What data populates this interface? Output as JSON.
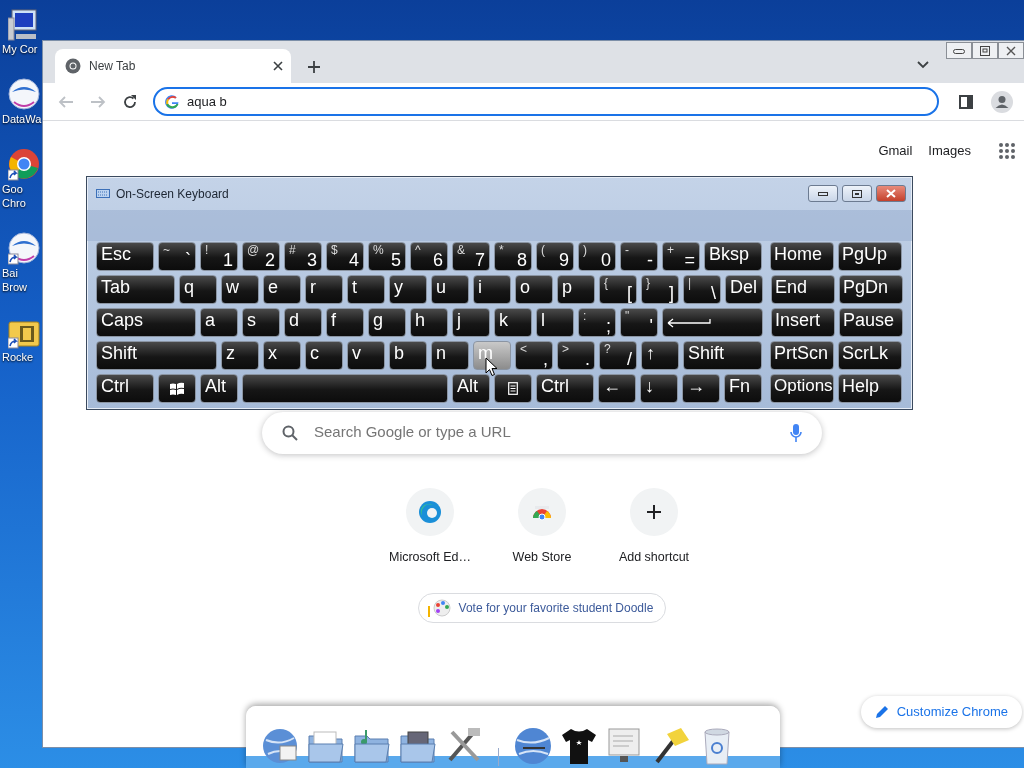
{
  "desktop": {
    "icons": [
      {
        "lines": [
          "My Cor"
        ],
        "shortcut": false
      },
      {
        "lines": [
          "DataWa"
        ],
        "shortcut": false
      },
      {
        "lines": [
          "Goo",
          "Chro"
        ],
        "shortcut": true
      },
      {
        "lines": [
          "Bai",
          "Brow"
        ],
        "shortcut": true
      },
      {
        "lines": [
          "Rocke"
        ],
        "shortcut": true
      }
    ]
  },
  "browser": {
    "tabs": [
      {
        "title": "New Tab",
        "selected": true
      }
    ],
    "nav_buttons": [
      {
        "kind": "back",
        "disabled": true
      },
      {
        "kind": "forward",
        "disabled": true
      },
      {
        "kind": "reload",
        "disabled": false
      }
    ],
    "address": {
      "value": "aqua b"
    },
    "top_links": [
      "Gmail",
      "Images"
    ],
    "search": {
      "placeholder": "Search Google or type a URL"
    },
    "shortcuts": [
      {
        "label": "Microsoft Ed…",
        "kind": "edge"
      },
      {
        "label": "Web Store",
        "kind": "store"
      },
      {
        "label": "Add shortcut",
        "kind": "add"
      }
    ],
    "doodle_chip": {
      "label": "Vote for your favorite student Doodle"
    },
    "customize_button": {
      "label": "Customize Chrome"
    }
  },
  "keyboard_window": {
    "title": "On-Screen Keyboard",
    "rows": [
      {
        "main": [
          {
            "label": "Esc",
            "kind": "medium",
            "hovered": false
          },
          {
            "shift": "~",
            "label": "`",
            "kind": "key",
            "hovered": false
          },
          {
            "shift": "!",
            "label": "1",
            "kind": "key",
            "hovered": false
          },
          {
            "shift": "@",
            "label": "2",
            "kind": "key",
            "hovered": false
          },
          {
            "shift": "#",
            "label": "3",
            "kind": "key",
            "hovered": false
          },
          {
            "shift": "$",
            "label": "4",
            "kind": "key",
            "hovered": false
          },
          {
            "shift": "%",
            "label": "5",
            "kind": "key",
            "hovered": false
          },
          {
            "shift": "^",
            "label": "6",
            "kind": "key",
            "hovered": false
          },
          {
            "shift": "&",
            "label": "7",
            "kind": "key",
            "hovered": false
          },
          {
            "shift": "*",
            "label": "8",
            "kind": "key",
            "hovered": false
          },
          {
            "shift": "(",
            "label": "9",
            "kind": "key",
            "hovered": false
          },
          {
            "shift": ")",
            "label": "0",
            "kind": "key",
            "hovered": false
          },
          {
            "shift": "-",
            "label": "-",
            "kind": "key",
            "hovered": false
          },
          {
            "shift": "+",
            "label": "=",
            "kind": "key",
            "hovered": false
          },
          {
            "label": "Bksp",
            "kind": "medium",
            "hovered": false
          }
        ],
        "side": [
          {
            "label": "Home",
            "kind": "nav",
            "hovered": false
          },
          {
            "label": "PgUp",
            "kind": "nav",
            "hovered": false
          }
        ]
      },
      {
        "main": [
          {
            "label": "Tab",
            "kind": "wide",
            "hovered": false
          },
          {
            "label": "q",
            "kind": "key",
            "hovered": false
          },
          {
            "label": "w",
            "kind": "key",
            "hovered": false
          },
          {
            "label": "e",
            "kind": "key",
            "hovered": false
          },
          {
            "label": "r",
            "kind": "key",
            "hovered": false
          },
          {
            "label": "t",
            "kind": "key",
            "hovered": false
          },
          {
            "label": "y",
            "kind": "key",
            "hovered": false
          },
          {
            "label": "u",
            "kind": "key",
            "hovered": false
          },
          {
            "label": "i",
            "kind": "key",
            "hovered": false
          },
          {
            "label": "o",
            "kind": "key",
            "hovered": false
          },
          {
            "label": "p",
            "kind": "key",
            "hovered": false
          },
          {
            "shift": "{",
            "label": "[",
            "kind": "key",
            "hovered": false
          },
          {
            "shift": "}",
            "label": "]",
            "kind": "key",
            "hovered": false
          },
          {
            "shift": "|",
            "label": "\\",
            "kind": "key",
            "hovered": false
          },
          {
            "label": "Del",
            "kind": "key",
            "hovered": false
          }
        ],
        "side": [
          {
            "label": "End",
            "kind": "nav",
            "hovered": false
          },
          {
            "label": "PgDn",
            "kind": "nav",
            "hovered": false
          }
        ]
      },
      {
        "main": [
          {
            "label": "Caps",
            "kind": "wider",
            "hovered": false
          },
          {
            "label": "a",
            "kind": "key",
            "hovered": false
          },
          {
            "label": "s",
            "kind": "key",
            "hovered": false
          },
          {
            "label": "d",
            "kind": "key",
            "hovered": false
          },
          {
            "label": "f",
            "kind": "key",
            "hovered": false
          },
          {
            "label": "g",
            "kind": "key",
            "hovered": false
          },
          {
            "label": "h",
            "kind": "key",
            "hovered": false
          },
          {
            "label": "j",
            "kind": "key",
            "hovered": false
          },
          {
            "label": "k",
            "kind": "key",
            "hovered": false
          },
          {
            "label": "l",
            "kind": "key",
            "hovered": false
          },
          {
            "shift": ":",
            "label": ";",
            "kind": "key",
            "hovered": false
          },
          {
            "shift": "\"",
            "label": "'",
            "kind": "key",
            "hovered": false
          },
          {
            "kind": "enter",
            "hovered": false
          }
        ],
        "side": [
          {
            "label": "Insert",
            "kind": "nav",
            "hovered": false
          },
          {
            "label": "Pause",
            "kind": "nav",
            "hovered": false
          }
        ]
      },
      {
        "main": [
          {
            "label": "Shift",
            "kind": "widest",
            "hovered": false
          },
          {
            "label": "z",
            "kind": "key",
            "hovered": false
          },
          {
            "label": "x",
            "kind": "key",
            "hovered": false
          },
          {
            "label": "c",
            "kind": "key",
            "hovered": false
          },
          {
            "label": "v",
            "kind": "key",
            "hovered": false
          },
          {
            "label": "b",
            "kind": "key",
            "hovered": false
          },
          {
            "label": "n",
            "kind": "key",
            "hovered": false
          },
          {
            "label": "m",
            "kind": "key",
            "hovered": true
          },
          {
            "shift": "<",
            "label": ",",
            "kind": "key",
            "hovered": false
          },
          {
            "shift": ">",
            "label": ".",
            "kind": "key",
            "hovered": false
          },
          {
            "shift": "?",
            "label": "/",
            "kind": "key",
            "hovered": false
          },
          {
            "label": "↑",
            "kind": "key",
            "hovered": false
          },
          {
            "label": "Shift",
            "kind": "wide",
            "hovered": false
          }
        ],
        "side": [
          {
            "label": "PrtScn",
            "kind": "nav",
            "hovered": false
          },
          {
            "label": "ScrLk",
            "kind": "nav",
            "hovered": false
          }
        ]
      },
      {
        "main": [
          {
            "label": "Ctrl",
            "kind": "medium",
            "hovered": false
          },
          {
            "kind": "win",
            "hovered": false
          },
          {
            "label": "Alt",
            "kind": "key",
            "hovered": false
          },
          {
            "kind": "space",
            "hovered": false
          },
          {
            "label": "Alt",
            "kind": "key",
            "hovered": false
          },
          {
            "kind": "menu",
            "hovered": false
          },
          {
            "label": "Ctrl",
            "kind": "medium",
            "hovered": false
          },
          {
            "label": "←",
            "kind": "key",
            "hovered": false
          },
          {
            "label": "↓",
            "kind": "key",
            "hovered": false
          },
          {
            "label": "→",
            "kind": "key",
            "hovered": false
          },
          {
            "label": "Fn",
            "kind": "key",
            "hovered": false
          }
        ],
        "side": [
          {
            "label": "Options",
            "kind": "nav",
            "hovered": false
          },
          {
            "label": "Help",
            "kind": "nav",
            "hovered": false
          }
        ]
      }
    ]
  }
}
